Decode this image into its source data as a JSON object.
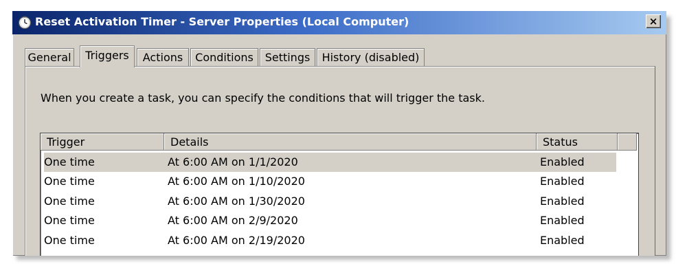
{
  "window": {
    "title": "Reset Activation Timer - Server Properties (Local Computer)",
    "close_glyph": "×"
  },
  "tabs": [
    {
      "label": "General",
      "active": false
    },
    {
      "label": "Triggers",
      "active": true
    },
    {
      "label": "Actions",
      "active": false
    },
    {
      "label": "Conditions",
      "active": false
    },
    {
      "label": "Settings",
      "active": false
    },
    {
      "label": "History (disabled)",
      "active": false
    }
  ],
  "triggers_panel": {
    "description": "When you create a task, you can specify the conditions that will trigger the task.",
    "columns": {
      "trigger": "Trigger",
      "details": "Details",
      "status": "Status"
    },
    "rows": [
      {
        "trigger": "One time",
        "details": "At 6:00 AM on 1/1/2020",
        "status": "Enabled",
        "selected": true
      },
      {
        "trigger": "One time",
        "details": "At 6:00 AM on 1/10/2020",
        "status": "Enabled",
        "selected": false
      },
      {
        "trigger": "One time",
        "details": "At 6:00 AM on 1/30/2020",
        "status": "Enabled",
        "selected": false
      },
      {
        "trigger": "One time",
        "details": "At 6:00 AM on 2/9/2020",
        "status": "Enabled",
        "selected": false
      },
      {
        "trigger": "One time",
        "details": "At 6:00 AM on 2/19/2020",
        "status": "Enabled",
        "selected": false
      }
    ]
  },
  "colors": {
    "title_gradient_start": "#0a246a",
    "title_gradient_end": "#a6caf0",
    "face": "#d4d0c8",
    "selection": "#d4d0c8"
  },
  "icons": {
    "app": "task-scheduler-clock-icon",
    "close": "close-icon"
  }
}
